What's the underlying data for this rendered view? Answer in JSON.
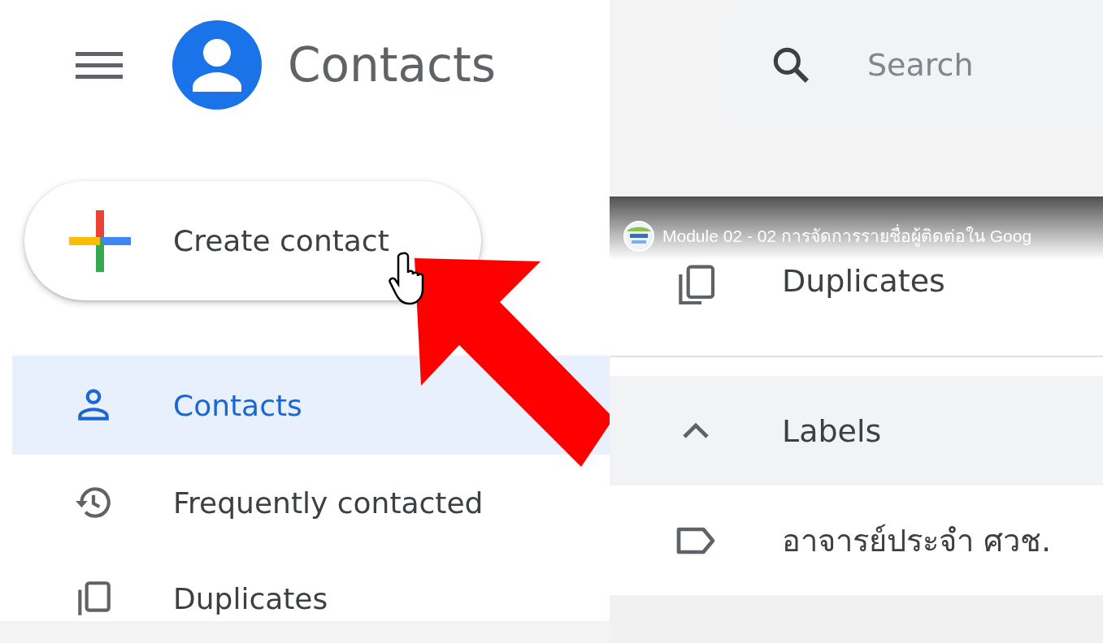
{
  "header": {
    "app_title": "Contacts"
  },
  "search": {
    "placeholder": "Search"
  },
  "create_button": {
    "label": "Create contact"
  },
  "nav": [
    {
      "kind": "person",
      "label": "Contacts",
      "selected": true
    },
    {
      "kind": "history",
      "label": "Frequently contacted",
      "selected": false
    },
    {
      "kind": "copy",
      "label": "Duplicates",
      "selected": false
    }
  ],
  "inset": {
    "video_title": "Module 02 - 02 การจัดการรายชื่อผู้ติดต่อใน Goog",
    "items": [
      {
        "kind": "item",
        "label": "Duplicates"
      },
      {
        "kind": "section",
        "label": "Labels",
        "expanded": true
      },
      {
        "kind": "label",
        "label": "อาจารย์ประจำ ศวช."
      }
    ]
  }
}
